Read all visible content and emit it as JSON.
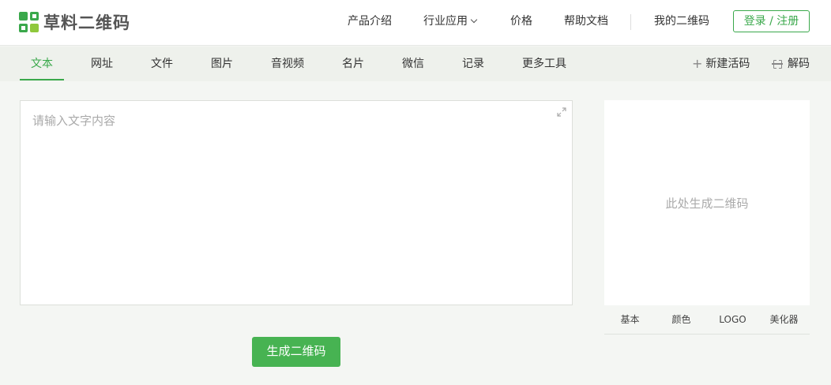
{
  "brand": {
    "name": "草料二维码"
  },
  "top_nav": {
    "items": [
      {
        "label": "产品介绍"
      },
      {
        "label": "行业应用"
      },
      {
        "label": "价格"
      },
      {
        "label": "帮助文档"
      },
      {
        "label": "我的二维码"
      }
    ],
    "login_label": "登录 / 注册"
  },
  "tabs": {
    "items": [
      {
        "label": "文本"
      },
      {
        "label": "网址"
      },
      {
        "label": "文件"
      },
      {
        "label": "图片"
      },
      {
        "label": "音视频"
      },
      {
        "label": "名片"
      },
      {
        "label": "微信"
      },
      {
        "label": "记录"
      },
      {
        "label": "更多工具"
      }
    ],
    "active": "文本",
    "new_code_label": "新建活码",
    "decode_label": "解码"
  },
  "editor": {
    "placeholder": "请输入文字内容",
    "value": ""
  },
  "generate_button": {
    "label": "生成二维码"
  },
  "preview": {
    "placeholder": "此处生成二维码",
    "tabs": [
      {
        "label": "基本"
      },
      {
        "label": "颜色"
      },
      {
        "label": "LOGO"
      },
      {
        "label": "美化器"
      }
    ]
  },
  "colors": {
    "accent": "#3aa84b",
    "button": "#47b352",
    "tabbar_bg": "#eef1ec",
    "page_bg": "#f4f6f3"
  },
  "icons": {
    "logo": "qr-logo-icon",
    "expand": "expand-icon",
    "plus": "plus-icon",
    "decode": "scan-icon",
    "dropdown": "chevron-down-icon"
  }
}
